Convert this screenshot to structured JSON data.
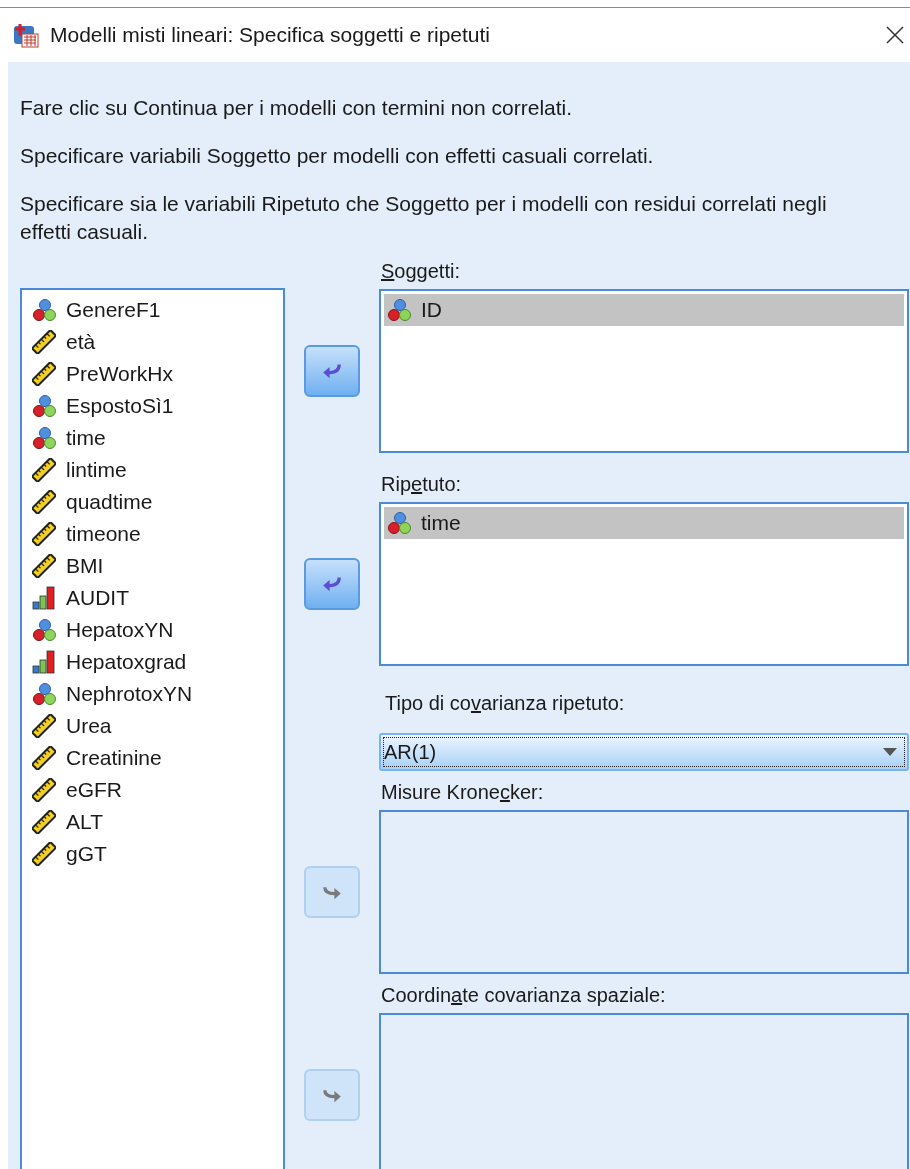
{
  "window": {
    "title": "Modelli misti lineari: Specifica soggetti e ripetuti"
  },
  "instructions": [
    "Fare clic su Continua per i modelli con termini non correlati.",
    "Specificare variabili Soggetto per modelli con effetti casuali correlati.",
    "Specificare sia le variabili Ripetuto che Soggetto per i modelli con residui correlati negli effetti casuali."
  ],
  "variables": [
    {
      "name": "GenereF1",
      "kind": "nominal",
      "selected": false
    },
    {
      "name": "età",
      "kind": "scale",
      "selected": false
    },
    {
      "name": "PreWorkHx",
      "kind": "scale",
      "selected": false
    },
    {
      "name": "EspostoSì1",
      "kind": "nominal",
      "selected": false
    },
    {
      "name": "time",
      "kind": "nominal",
      "selected": false
    },
    {
      "name": "lintime",
      "kind": "scale",
      "selected": false
    },
    {
      "name": "quadtime",
      "kind": "scale",
      "selected": false
    },
    {
      "name": "timeone",
      "kind": "scale",
      "selected": false
    },
    {
      "name": "BMI",
      "kind": "scale",
      "selected": false
    },
    {
      "name": "AUDIT",
      "kind": "ordinal",
      "selected": false
    },
    {
      "name": "HepatoxYN",
      "kind": "nominal",
      "selected": false
    },
    {
      "name": "Hepatoxgrad",
      "kind": "ordinal",
      "selected": false
    },
    {
      "name": "NephrotoxYN",
      "kind": "nominal",
      "selected": false
    },
    {
      "name": "Urea",
      "kind": "scale",
      "selected": false
    },
    {
      "name": "Creatinine",
      "kind": "scale",
      "selected": false
    },
    {
      "name": "eGFR",
      "kind": "scale",
      "selected": false
    },
    {
      "name": "ALT",
      "kind": "scale",
      "selected": false
    },
    {
      "name": "gGT",
      "kind": "scale",
      "selected": false
    }
  ],
  "sections": [
    {
      "kind": "list",
      "label": {
        "key": "S",
        "post": "oggetti:"
      },
      "button": {
        "kind": "remove",
        "disabled": false
      },
      "disabled": false,
      "items": [
        {
          "name": "ID",
          "kind": "nominal",
          "selected": true
        }
      ]
    },
    {
      "kind": "list",
      "label": {
        "pre": "Rip",
        "key": "e",
        "post": "tuto:"
      },
      "button": {
        "kind": "remove",
        "disabled": false
      },
      "disabled": false,
      "items": [
        {
          "name": "time",
          "kind": "nominal",
          "selected": true
        }
      ]
    },
    {
      "kind": "dropdown",
      "label": {
        "pre": "Tipo di co",
        "key": "v",
        "post": "arianza ripetuto:"
      },
      "value": "AR(1)",
      "focused": true
    },
    {
      "kind": "list",
      "label": {
        "pre": "Misure Krone",
        "key": "c",
        "post": "ker:"
      },
      "button": {
        "kind": "add",
        "disabled": true
      },
      "disabled": true
    },
    {
      "kind": "list",
      "label": {
        "pre": "Coordin",
        "key": "a",
        "post": "te covarianza spaziale:"
      },
      "button": {
        "kind": "add",
        "disabled": true
      },
      "disabled": true
    }
  ]
}
